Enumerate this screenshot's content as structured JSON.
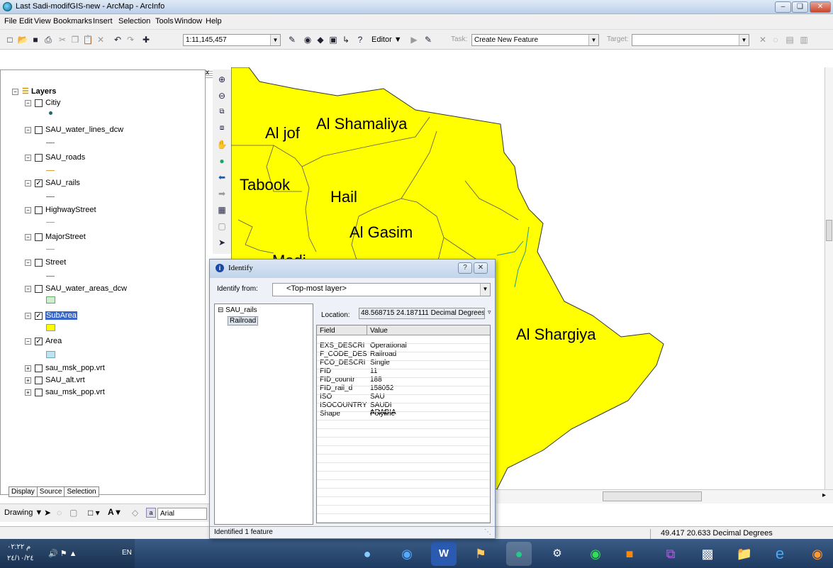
{
  "window": {
    "title": "Last Sadi-modifGIS-new - ArcMap - ArcInfo"
  },
  "menu": [
    "File",
    "Edit",
    "View",
    "Bookmarks",
    "Insert",
    "Selection",
    "Tools",
    "Window",
    "Help"
  ],
  "toolbar": {
    "scale": "1:11,145,457",
    "editor": "Editor",
    "task_label": "Task:",
    "task_value": "Create New Feature",
    "target_label": "Target:"
  },
  "toc": {
    "root": "Layers",
    "layers": [
      {
        "name": "Citiy",
        "checked": false
      },
      {
        "name": "SAU_water_lines_dcw",
        "checked": false
      },
      {
        "name": "SAU_roads",
        "checked": false
      },
      {
        "name": "SAU_rails",
        "checked": true
      },
      {
        "name": "HighwayStreet",
        "checked": false
      },
      {
        "name": "MajorStreet",
        "checked": false
      },
      {
        "name": "Street",
        "checked": false
      },
      {
        "name": "SAU_water_areas_dcw",
        "checked": false
      },
      {
        "name": "SubArea",
        "checked": true
      },
      {
        "name": "Area",
        "checked": true
      },
      {
        "name": "sau_msk_pop.vrt",
        "checked": false
      },
      {
        "name": "SAU_alt.vrt",
        "checked": false
      },
      {
        "name": "sau_msk_pop.vrt",
        "checked": false
      }
    ],
    "tabs": [
      "Display",
      "Source",
      "Selection"
    ]
  },
  "drawing": {
    "label": "Drawing",
    "font": "Arial"
  },
  "map": {
    "labels": [
      "Al jof",
      "Al Shamaliya",
      "Tabook",
      "Hail",
      "Al Gasim",
      "Al Shargiya",
      "Madi"
    ]
  },
  "identify": {
    "title": "Identify",
    "from_label": "Identify from:",
    "from_value": "<Top-most layer>",
    "tree_layer": "SAU_rails",
    "tree_feature": "Railroad",
    "location_label": "Location:",
    "location_value": "48.568715  24.187111 Decimal Degrees",
    "col_field": "Field",
    "col_value": "Value",
    "rows": [
      {
        "f": "EXS_DESCRI",
        "v": "Operational"
      },
      {
        "f": "F_CODE_DES",
        "v": "Railroad"
      },
      {
        "f": "FCO_DESCRI",
        "v": "Single"
      },
      {
        "f": "FID",
        "v": "11"
      },
      {
        "f": "FID_countr",
        "v": "188"
      },
      {
        "f": "FID_rail_d",
        "v": "158052"
      },
      {
        "f": "ISO",
        "v": "SAU"
      },
      {
        "f": "ISOCOUNTRY",
        "v": "SAUDI ARABIA"
      },
      {
        "f": "Shape",
        "v": "Polyline"
      }
    ],
    "status": "Identified 1 feature"
  },
  "status": {
    "coords": "49.417  20.633 Decimal Degrees"
  },
  "taskbar": {
    "time": "م ٠٢:٢٢",
    "date": "٢٤/١٠/٢٤",
    "lang": "EN"
  },
  "colors": {
    "map_fill": "#ffff00",
    "title_bg": "#c2d4eb"
  }
}
